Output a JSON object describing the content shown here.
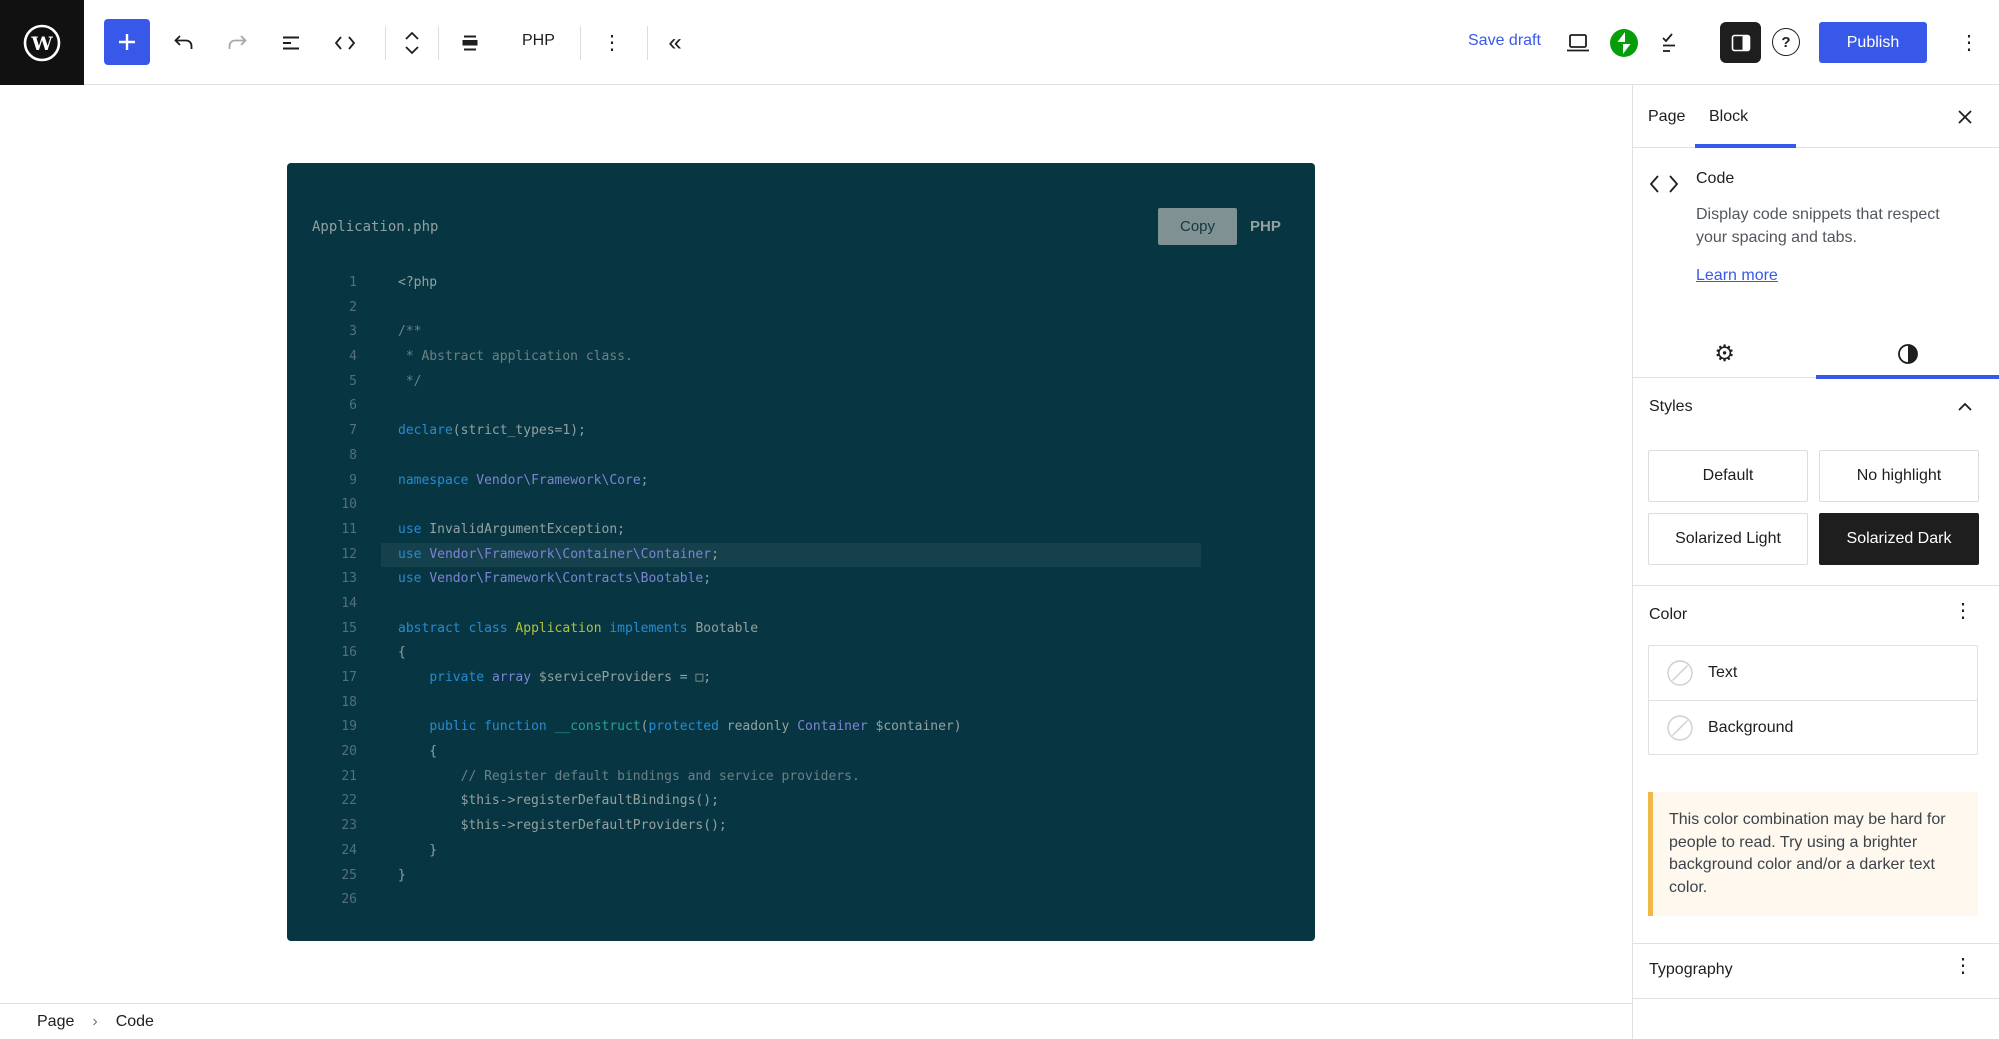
{
  "colors": {
    "accent_blue": "#3858e9",
    "publish_blue": "#3858e9",
    "code_background": "#073642",
    "code_plain": "#93a1a1",
    "code_keyword": "#268bd2",
    "code_comment": "#6b8086",
    "code_class_path": "#7c84d2",
    "code_class_title": "#b2c13c",
    "code_function": "#2aa198",
    "warning_bg": "#fef8ee",
    "warning_border": "#f0b849",
    "jetpack_green": "#069e08"
  },
  "icons": {
    "options_glyph": "⋮",
    "collapse_glyph": "«",
    "breadcrumb_sep_glyph": "›",
    "gear_glyph": "⚙"
  },
  "top_bar": {
    "language_label": "PHP",
    "save_draft_label": "Save draft",
    "publish_label": "Publish"
  },
  "code_block": {
    "filename": "Application.php",
    "copy_label": "Copy",
    "language_badge": "PHP",
    "lines": [
      {
        "n": 1,
        "tokens": [
          {
            "t": "<?php",
            "c": "p"
          }
        ]
      },
      {
        "n": 2,
        "tokens": []
      },
      {
        "n": 3,
        "tokens": [
          {
            "t": "/**",
            "c": "c"
          }
        ]
      },
      {
        "n": 4,
        "tokens": [
          {
            "t": " * Abstract application class.",
            "c": "c"
          }
        ]
      },
      {
        "n": 5,
        "tokens": [
          {
            "t": " */",
            "c": "c"
          }
        ]
      },
      {
        "n": 6,
        "tokens": []
      },
      {
        "n": 7,
        "tokens": [
          {
            "t": "declare",
            "c": "k"
          },
          {
            "t": "(strict_types=1);",
            "c": "p"
          }
        ]
      },
      {
        "n": 8,
        "tokens": []
      },
      {
        "n": 9,
        "tokens": [
          {
            "t": "namespace",
            "c": "k"
          },
          {
            "t": " ",
            "c": "p"
          },
          {
            "t": "Vendor\\Framework\\Core",
            "c": "v"
          },
          {
            "t": ";",
            "c": "p"
          }
        ]
      },
      {
        "n": 10,
        "tokens": []
      },
      {
        "n": 11,
        "tokens": [
          {
            "t": "use",
            "c": "k"
          },
          {
            "t": " InvalidArgumentException;",
            "c": "p"
          }
        ]
      },
      {
        "n": 12,
        "hl": true,
        "tokens": [
          {
            "t": "use",
            "c": "k"
          },
          {
            "t": " ",
            "c": "p"
          },
          {
            "t": "Vendor\\Framework\\Container\\Container",
            "c": "v"
          },
          {
            "t": ";",
            "c": "p"
          }
        ]
      },
      {
        "n": 13,
        "tokens": [
          {
            "t": "use",
            "c": "k"
          },
          {
            "t": " ",
            "c": "p"
          },
          {
            "t": "Vendor\\Framework\\Contracts\\Bootable",
            "c": "v"
          },
          {
            "t": ";",
            "c": "p"
          }
        ]
      },
      {
        "n": 14,
        "tokens": []
      },
      {
        "n": 15,
        "tokens": [
          {
            "t": "abstract",
            "c": "k"
          },
          {
            "t": " ",
            "c": "p"
          },
          {
            "t": "class",
            "c": "k"
          },
          {
            "t": " ",
            "c": "p"
          },
          {
            "t": "Application",
            "c": "g"
          },
          {
            "t": " ",
            "c": "p"
          },
          {
            "t": "implements",
            "c": "k"
          },
          {
            "t": " Bootable",
            "c": "p"
          }
        ]
      },
      {
        "n": 16,
        "tokens": [
          {
            "t": "{",
            "c": "p"
          }
        ]
      },
      {
        "n": 17,
        "tokens": [
          {
            "t": "    ",
            "c": "p"
          },
          {
            "t": "private",
            "c": "k"
          },
          {
            "t": " ",
            "c": "p"
          },
          {
            "t": "array",
            "c": "v"
          },
          {
            "t": " $serviceProviders = □;",
            "c": "p"
          }
        ]
      },
      {
        "n": 18,
        "tokens": []
      },
      {
        "n": 19,
        "tokens": [
          {
            "t": "    ",
            "c": "p"
          },
          {
            "t": "public",
            "c": "k"
          },
          {
            "t": " ",
            "c": "p"
          },
          {
            "t": "function",
            "c": "k"
          },
          {
            "t": " ",
            "c": "p"
          },
          {
            "t": "__construct",
            "c": "f"
          },
          {
            "t": "(",
            "c": "p"
          },
          {
            "t": "protected",
            "c": "k"
          },
          {
            "t": " readonly ",
            "c": "p"
          },
          {
            "t": "Container",
            "c": "v"
          },
          {
            "t": " $container)",
            "c": "p"
          }
        ]
      },
      {
        "n": 20,
        "tokens": [
          {
            "t": "    {",
            "c": "p"
          }
        ]
      },
      {
        "n": 21,
        "tokens": [
          {
            "t": "        ",
            "c": "p"
          },
          {
            "t": "// Register default bindings and service providers.",
            "c": "c"
          }
        ]
      },
      {
        "n": 22,
        "tokens": [
          {
            "t": "        $this->registerDefaultBindings();",
            "c": "p"
          }
        ]
      },
      {
        "n": 23,
        "tokens": [
          {
            "t": "        $this->registerDefaultProviders();",
            "c": "p"
          }
        ]
      },
      {
        "n": 24,
        "tokens": [
          {
            "t": "    }",
            "c": "p"
          }
        ]
      },
      {
        "n": 25,
        "tokens": [
          {
            "t": "}",
            "c": "p"
          }
        ]
      },
      {
        "n": 26,
        "tokens": []
      }
    ]
  },
  "sidebar": {
    "tabs": [
      {
        "label": "Page",
        "active": false
      },
      {
        "label": "Block",
        "active": true
      }
    ],
    "block_card": {
      "title": "Code",
      "description": "Display code snippets that respect your spacing and tabs.",
      "learn_more": "Learn more"
    },
    "styles": {
      "heading": "Styles",
      "options": [
        {
          "label": "Default",
          "selected": false
        },
        {
          "label": "No highlight",
          "selected": false
        },
        {
          "label": "Solarized Light",
          "selected": false
        },
        {
          "label": "Solarized Dark",
          "selected": true
        }
      ]
    },
    "color": {
      "heading": "Color",
      "rows": [
        {
          "label": "Text"
        },
        {
          "label": "Background"
        }
      ],
      "warning": "This color combination may be hard for people to read. Try using a brighter background color and/or a darker text color."
    },
    "typography": {
      "heading": "Typography"
    }
  },
  "breadcrumb": {
    "items": [
      "Page",
      "Code"
    ]
  }
}
